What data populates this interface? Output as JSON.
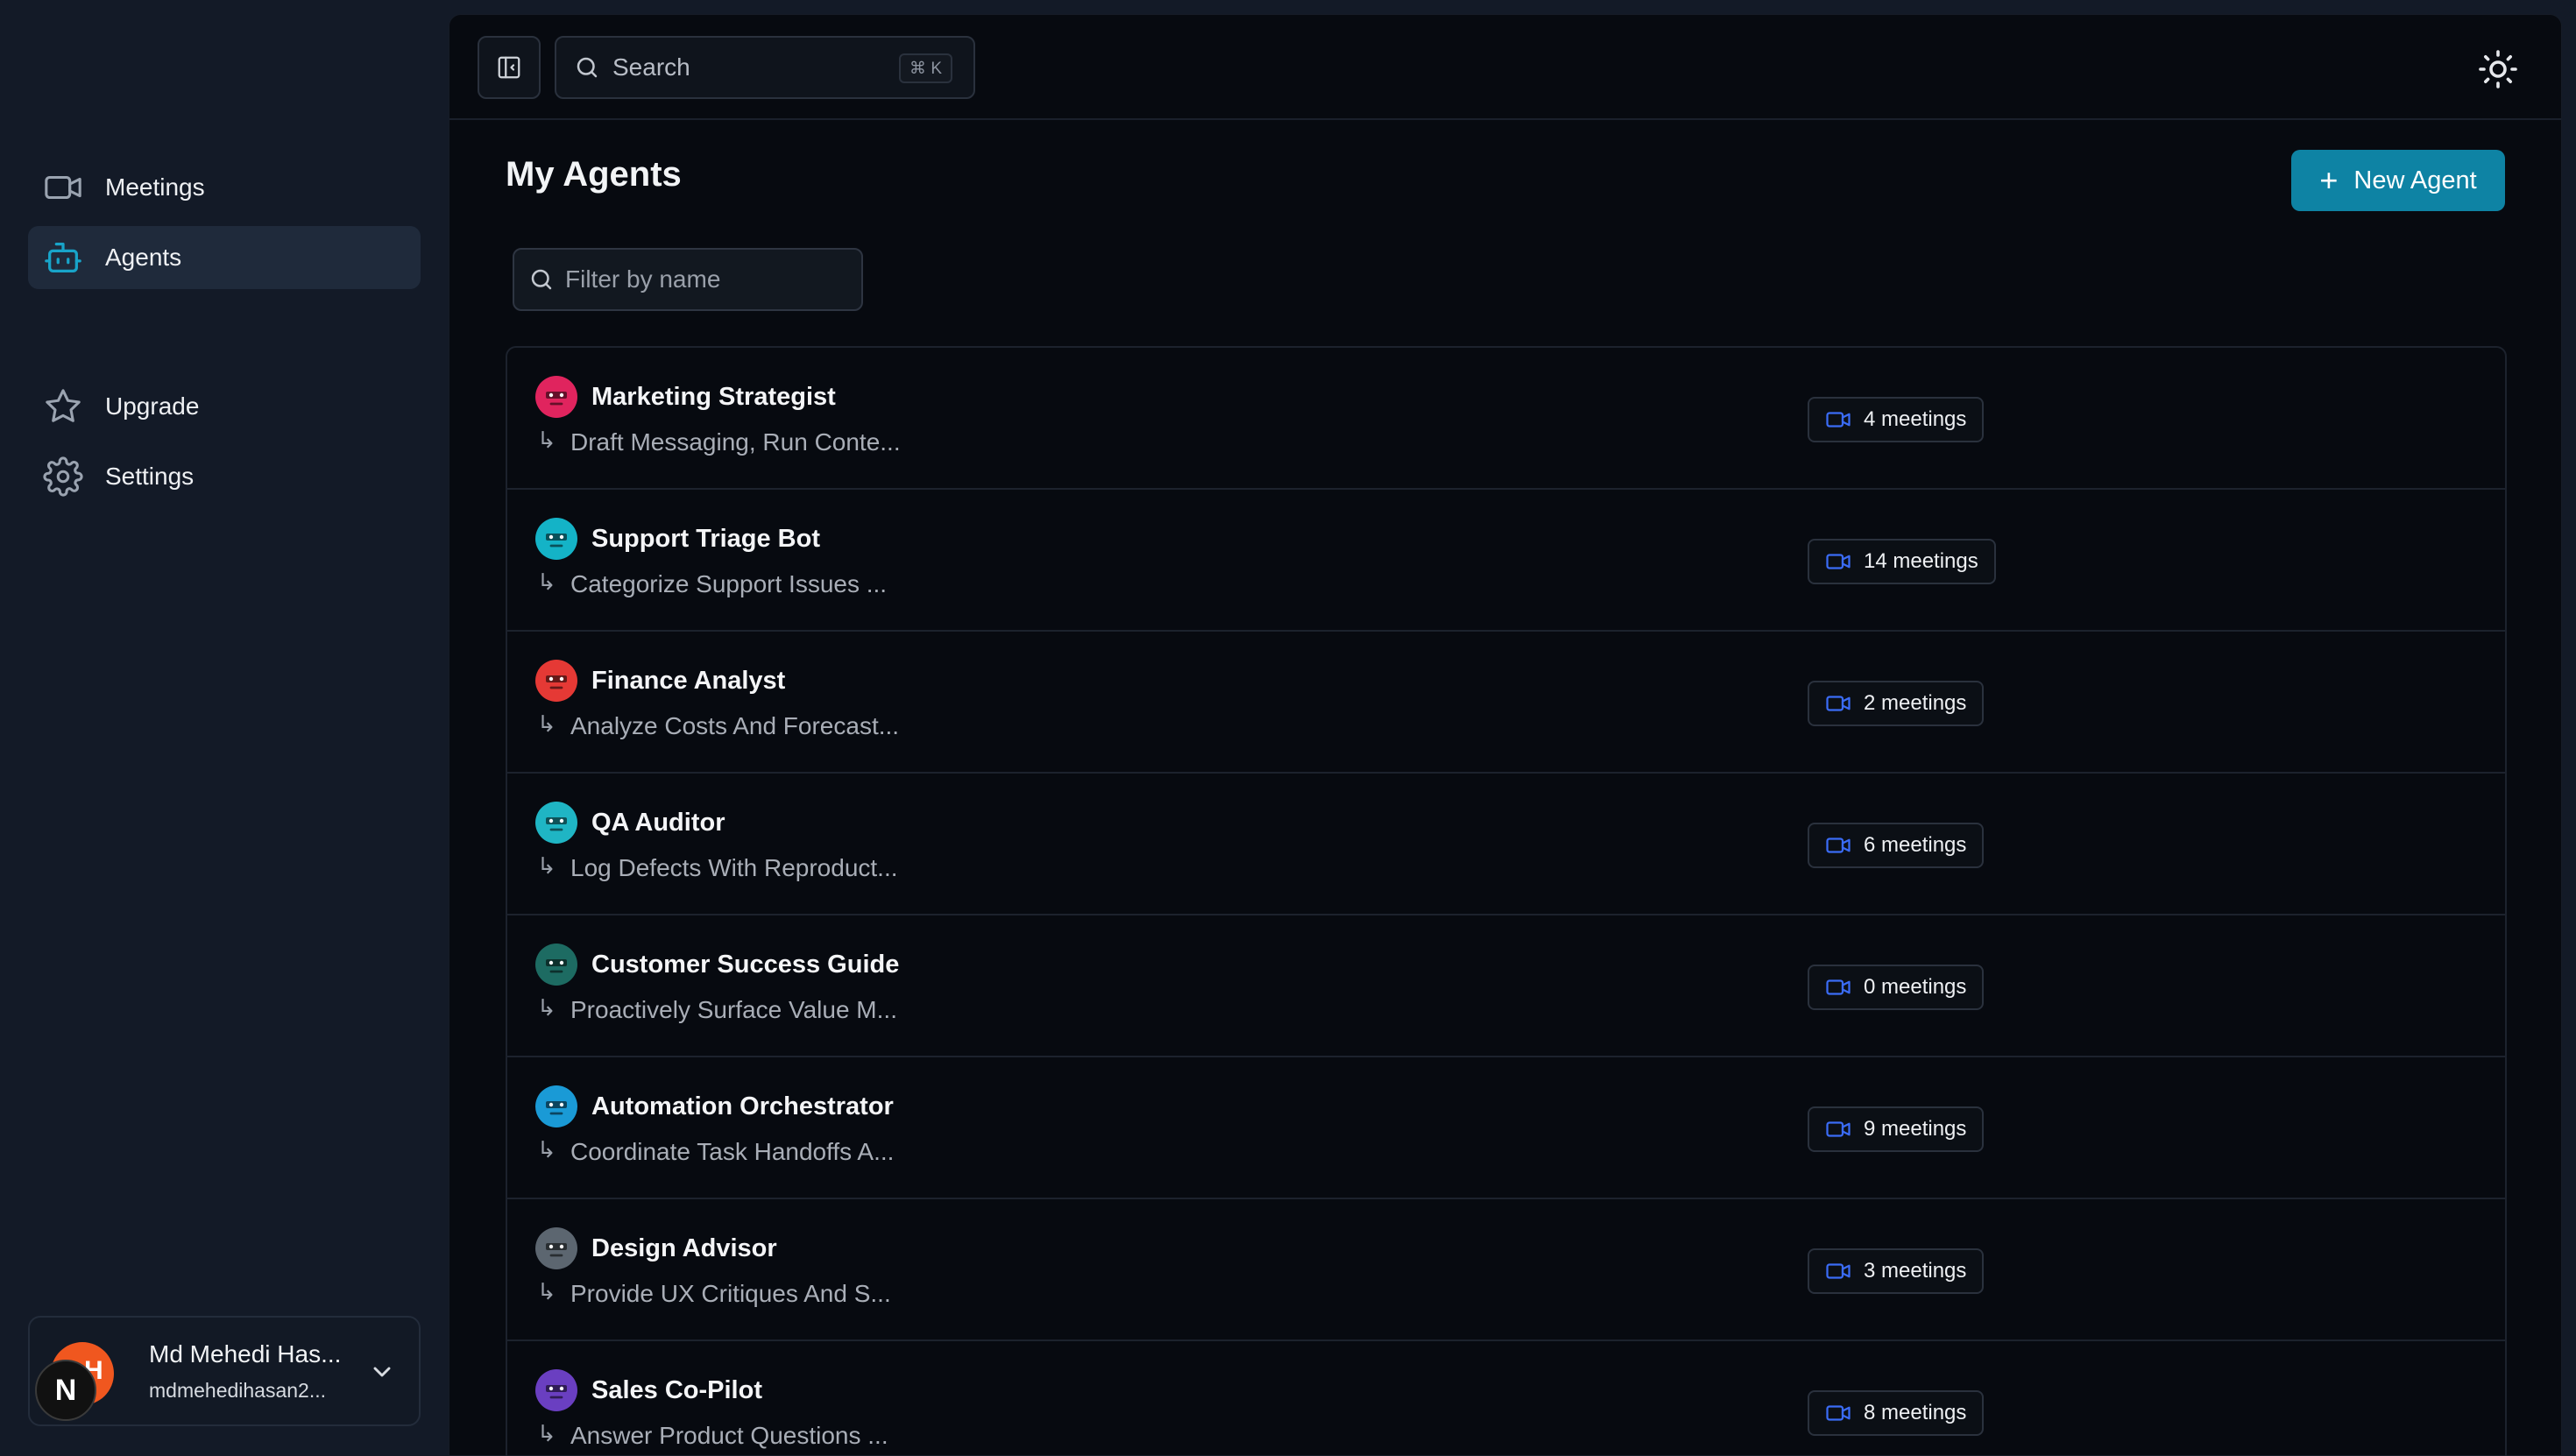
{
  "sidebar": {
    "nav_main": [
      {
        "label": "Meetings",
        "icon": "video-icon",
        "active": false
      },
      {
        "label": "Agents",
        "icon": "bot-icon",
        "active": true
      }
    ],
    "nav_secondary": [
      {
        "label": "Upgrade",
        "icon": "star-icon"
      },
      {
        "label": "Settings",
        "icon": "gear-icon"
      }
    ],
    "user": {
      "name": "Md Mehedi Has...",
      "email": "mdmehedihasan2...",
      "avatar_glyph": "H",
      "badge_glyph": "N"
    }
  },
  "topbar": {
    "search_label": "Search",
    "search_shortcut": "⌘ K"
  },
  "page": {
    "title": "My Agents",
    "new_agent_label": "New Agent",
    "filter_placeholder": "Filter by name"
  },
  "agents": [
    {
      "name": "Marketing Strategist",
      "description": "Draft Messaging, Run Conte...",
      "meetings": "4 meetings",
      "avatar_color": "#e0245e"
    },
    {
      "name": "Support Triage Bot",
      "description": "Categorize Support Issues ...",
      "meetings": "14 meetings",
      "avatar_color": "#14b3c7"
    },
    {
      "name": "Finance Analyst",
      "description": "Analyze Costs And Forecast...",
      "meetings": "2 meetings",
      "avatar_color": "#e53935"
    },
    {
      "name": "QA Auditor",
      "description": "Log Defects With Reproduct...",
      "meetings": "6 meetings",
      "avatar_color": "#1fb5c4"
    },
    {
      "name": "Customer Success Guide",
      "description": "Proactively Surface Value M...",
      "meetings": "0 meetings",
      "avatar_color": "#1d6b62"
    },
    {
      "name": "Automation Orchestrator",
      "description": "Coordinate Task Handoffs A...",
      "meetings": "9 meetings",
      "avatar_color": "#1a9ad6"
    },
    {
      "name": "Design Advisor",
      "description": "Provide UX Critiques And S...",
      "meetings": "3 meetings",
      "avatar_color": "#5c6670"
    },
    {
      "name": "Sales Co-Pilot",
      "description": "Answer Product Questions ...",
      "meetings": "8 meetings",
      "avatar_color": "#6a3fc1"
    }
  ],
  "colors": {
    "accent": "#0e83a4",
    "meeting_icon": "#3b6cf6",
    "active_icon": "#18a4c9"
  }
}
